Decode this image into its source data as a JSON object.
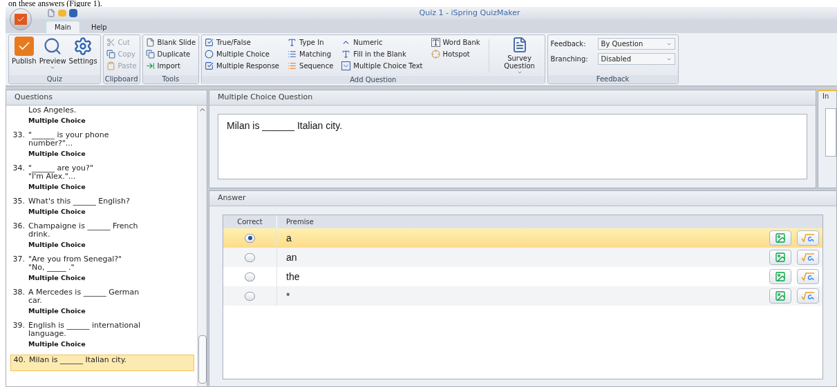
{
  "document_caption": "on these answers (Figure 1).",
  "window": {
    "title": "Quiz 1 - iSpring QuizMaker"
  },
  "tabs": [
    {
      "label": "Main",
      "selected": true
    },
    {
      "label": "Help",
      "selected": false
    }
  ],
  "ribbon": {
    "groups": [
      {
        "label": "Quiz",
        "kind": "large",
        "buttons": [
          {
            "label": "Publish"
          },
          {
            "label": "Preview"
          },
          {
            "label": "Settings"
          }
        ]
      },
      {
        "label": "Clipboard",
        "kind": "small",
        "columns": [
          [
            {
              "label": "Cut",
              "disabled": true
            },
            {
              "label": "Copy",
              "disabled": true
            },
            {
              "label": "Paste",
              "disabled": true
            }
          ]
        ]
      },
      {
        "label": "Tools",
        "kind": "small",
        "columns": [
          [
            {
              "label": "Blank Slide",
              "disabled": false
            },
            {
              "label": "Duplicate",
              "disabled": false
            },
            {
              "label": "Import",
              "disabled": false
            }
          ]
        ]
      },
      {
        "label": "Add Question",
        "kind": "small",
        "columns": [
          [
            {
              "label": "True/False",
              "disabled": false
            },
            {
              "label": "Multiple Choice",
              "disabled": false
            },
            {
              "label": "Multiple Response",
              "disabled": false
            }
          ],
          [
            {
              "label": "Type In",
              "disabled": false
            },
            {
              "label": "Matching",
              "disabled": false
            },
            {
              "label": "Sequence",
              "disabled": false
            }
          ],
          [
            {
              "label": "Numeric",
              "disabled": false
            },
            {
              "label": "Fill in the Blank",
              "disabled": false
            },
            {
              "label": "Multiple Choice Text",
              "disabled": false
            }
          ],
          [
            {
              "label": "Word Bank",
              "disabled": false
            },
            {
              "label": "Hotspot",
              "disabled": false
            }
          ]
        ],
        "large_button": {
          "label": "Survey Question"
        }
      },
      {
        "label": "Feedback",
        "kind": "fields",
        "fields": [
          {
            "label": "Feedback:",
            "value": "By Question"
          },
          {
            "label": "Branching:",
            "value": "Disabled"
          }
        ]
      }
    ]
  },
  "questions_panel": {
    "title": "Questions",
    "items": [
      {
        "text": "Los Angeles.",
        "type": "Multiple Choice",
        "selected": false
      },
      {
        "number": "33.",
        "text": "\"______ is your phone\nnumber?\"...",
        "type": "Multiple Choice",
        "selected": false
      },
      {
        "number": "34.",
        "text": "\"______ are you?\"\n\"I'm Alex.\"...",
        "type": "Multiple Choice",
        "selected": false
      },
      {
        "number": "35.",
        "text": "What's this ______ English?\n ",
        "type": "Multiple Choice",
        "selected": false
      },
      {
        "number": "36.",
        "text": "Champaigne is ______ French\ndrink.",
        "type": "Multiple Choice",
        "selected": false
      },
      {
        "number": "37.",
        "text": "\"Are you from Senegal?\"\n\"No, _____ .\"",
        "type": "Multiple Choice",
        "selected": false
      },
      {
        "number": "38.",
        "text": "A Mercedes is ______ German\ncar.",
        "type": "Multiple Choice",
        "selected": false
      },
      {
        "number": "39.",
        "text": "English is ______ international\nlanguage.",
        "type": "Multiple Choice",
        "selected": false
      },
      {
        "number": "40.",
        "text": "Milan is ______ Italian city.",
        "selected": true
      }
    ]
  },
  "question_panel": {
    "title": "Multiple Choice Question",
    "text": "Milan is ______ Italian city."
  },
  "side_panel": {
    "tab": "In"
  },
  "answer_panel": {
    "title": "Answer",
    "columns": [
      "Correct",
      "Premise"
    ],
    "rows": [
      {
        "premise": "a",
        "selected": true
      },
      {
        "premise": "an",
        "selected": false
      },
      {
        "premise": "the",
        "selected": false
      },
      {
        "premise": "*",
        "selected": false
      }
    ]
  }
}
